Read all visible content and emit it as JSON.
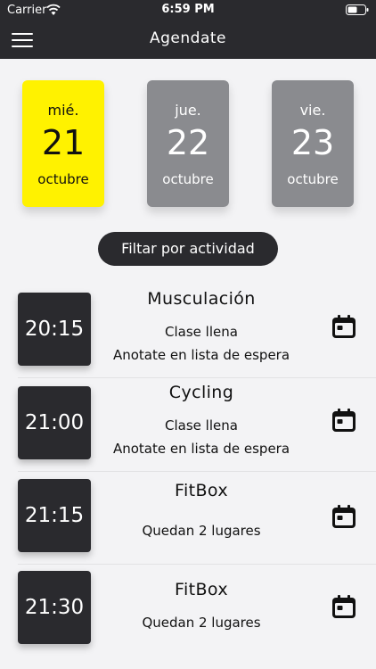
{
  "status_bar": {
    "carrier": "Carrier",
    "time": "6:59 PM"
  },
  "header": {
    "title": "Agendate",
    "menu_icon": "hamburger-menu-icon"
  },
  "dates": [
    {
      "weekday": "mié.",
      "day": "21",
      "month": "octubre",
      "selected": true
    },
    {
      "weekday": "jue.",
      "day": "22",
      "month": "octubre",
      "selected": false
    },
    {
      "weekday": "vie.",
      "day": "23",
      "month": "octubre",
      "selected": false
    }
  ],
  "filter": {
    "label": "Filtar por actividad"
  },
  "classes": [
    {
      "time": "20:15",
      "name": "Musculación",
      "line1": "Clase llena",
      "line2": "Anotate en lista de espera"
    },
    {
      "time": "21:00",
      "name": "Cycling",
      "line1": "Clase llena",
      "line2": "Anotate en lista de espera"
    },
    {
      "time": "21:15",
      "name": "FitBox",
      "line1": "Quedan 2 lugares",
      "line2": ""
    },
    {
      "time": "21:30",
      "name": "FitBox",
      "line1": "Quedan 2 lugares",
      "line2": ""
    }
  ],
  "colors": {
    "header": "#2a2a2e",
    "selected_date": "#fff200",
    "unselected_date": "#8a8b8f",
    "background": "#f3f3f5"
  }
}
